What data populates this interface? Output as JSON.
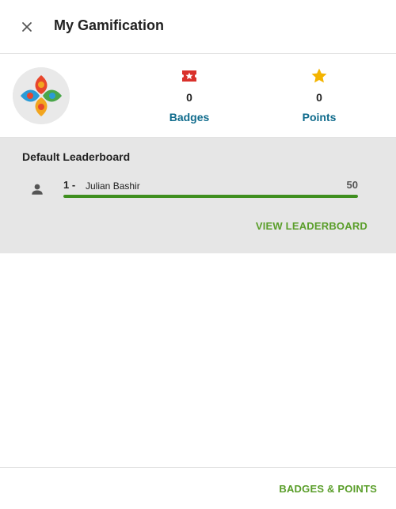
{
  "header": {
    "title": "My Gamification",
    "close_icon": "close-icon"
  },
  "profile": {
    "avatar_icon": "logo-avatar",
    "badges": {
      "count": "0",
      "label": "Badges",
      "icon": "badge-ticket-icon",
      "icon_color": "#d9312b"
    },
    "points": {
      "count": "0",
      "label": "Points",
      "icon": "star-icon",
      "icon_color": "#f4b400"
    }
  },
  "leaderboard": {
    "title": "Default Leaderboard",
    "rows": [
      {
        "rank": "1 -",
        "name": "Julian Bashir",
        "score": "50",
        "progress": 1.0
      }
    ],
    "view_label": "VIEW LEADERBOARD"
  },
  "footer": {
    "label": "BADGES & POINTS"
  },
  "colors": {
    "accent_green": "#5a9e2a",
    "link_blue": "#0f6b8c",
    "progress_green": "#3f8f1f",
    "panel_gray": "#e6e6e6"
  }
}
